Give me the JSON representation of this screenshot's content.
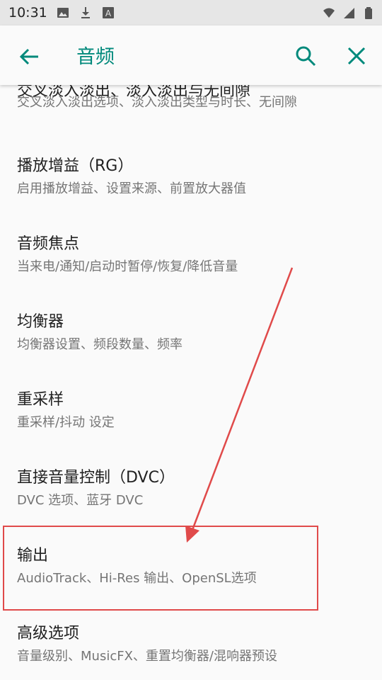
{
  "status_bar": {
    "time": "10:31",
    "left_icons": [
      "image-icon",
      "download-icon",
      "text-a-icon"
    ],
    "right_icons": [
      "wifi-icon",
      "signal-icon",
      "battery-icon"
    ]
  },
  "app_bar": {
    "title": "音频",
    "accent_color": "#00897b"
  },
  "items": [
    {
      "title": "交叉淡入淡出、淡入淡出与无间隙",
      "subtitle": "交叉淡入淡出选项、淡入淡出类型与时长、无间隙"
    },
    {
      "title": "播放增益（RG）",
      "subtitle": "启用播放增益、设置来源、前置放大器值"
    },
    {
      "title": "音频焦点",
      "subtitle": "当来电/通知/启动时暂停/恢复/降低音量"
    },
    {
      "title": "均衡器",
      "subtitle": "均衡器设置、频段数量、频率"
    },
    {
      "title": "重采样",
      "subtitle": "重采样/抖动 设定"
    },
    {
      "title": "直接音量控制（DVC）",
      "subtitle": "DVC 选项、蓝牙 DVC"
    },
    {
      "title": "输出",
      "subtitle": "AudioTrack、Hi-Res 输出、OpenSL选项"
    },
    {
      "title": "高级选项",
      "subtitle": "音量级别、MusicFX、重置均衡器/混响器预设"
    }
  ],
  "annotation": {
    "color": "#e04a4a",
    "highlighted_item": "输出"
  }
}
